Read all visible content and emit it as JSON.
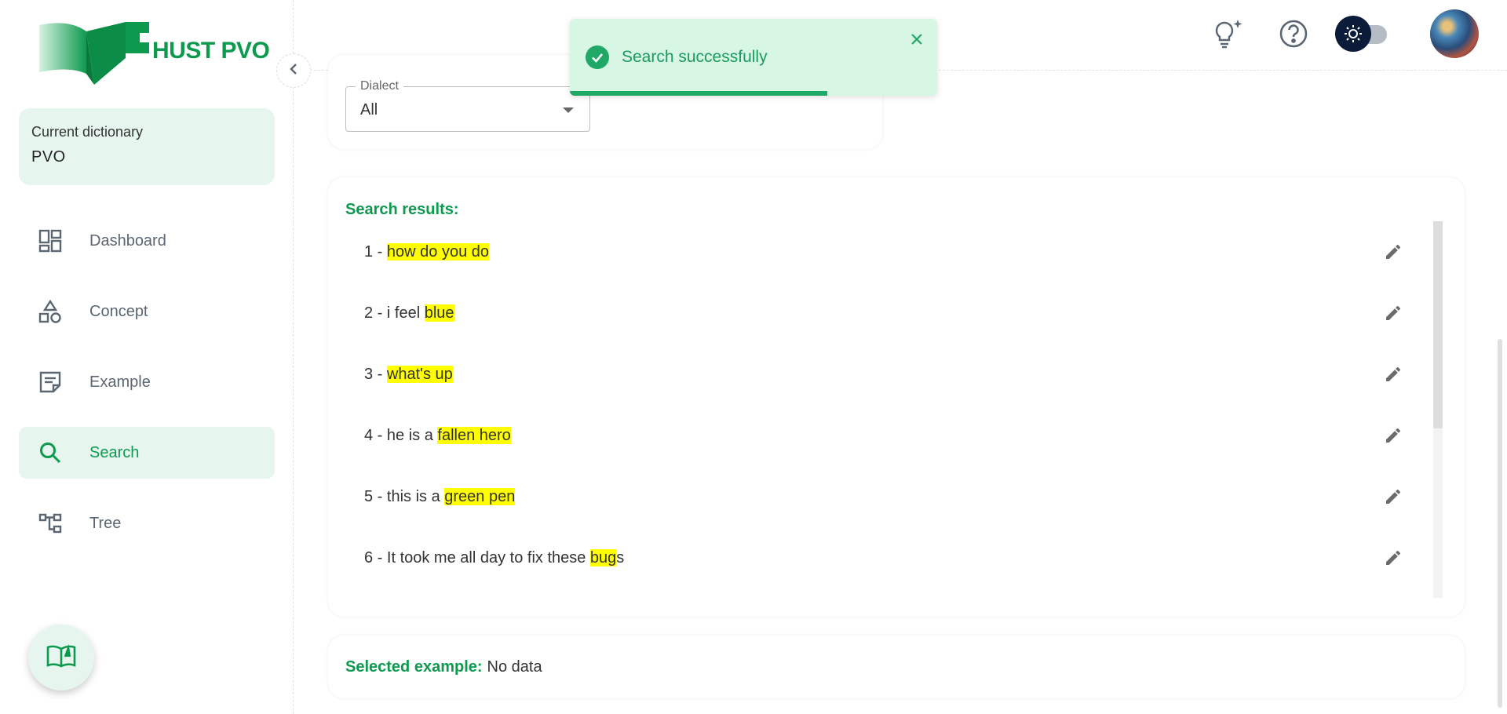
{
  "app": {
    "logo_text": "HUST PVO"
  },
  "sidebar": {
    "current_dictionary_label": "Current dictionary",
    "current_dictionary_value": "PVO",
    "items": [
      {
        "label": "Dashboard",
        "icon": "dashboard-icon",
        "active": false
      },
      {
        "label": "Concept",
        "icon": "concept-icon",
        "active": false
      },
      {
        "label": "Example",
        "icon": "example-icon",
        "active": false
      },
      {
        "label": "Search",
        "icon": "search-icon",
        "active": true
      },
      {
        "label": "Tree",
        "icon": "tree-icon",
        "active": false
      }
    ]
  },
  "header": {
    "icons": [
      "lightbulb-icon",
      "help-icon",
      "theme-toggle",
      "avatar"
    ]
  },
  "filter": {
    "dialect_label": "Dialect",
    "dialect_value": "All"
  },
  "results": {
    "title": "Search results:",
    "items": [
      {
        "index": "1",
        "sep": " - ",
        "before": "",
        "highlight": "how do you do",
        "after": ""
      },
      {
        "index": "2",
        "sep": " - ",
        "before": "i feel ",
        "highlight": "blue",
        "after": ""
      },
      {
        "index": "3",
        "sep": " - ",
        "before": "",
        "highlight": "what's up",
        "after": ""
      },
      {
        "index": "4",
        "sep": " - ",
        "before": "he is a ",
        "highlight": "fallen hero",
        "after": ""
      },
      {
        "index": "5",
        "sep": " - ",
        "before": "this is a ",
        "highlight": "green pen",
        "after": ""
      },
      {
        "index": "6",
        "sep": " - ",
        "before": "It took me all day to fix these ",
        "highlight": "bug",
        "after": "s"
      }
    ]
  },
  "selected": {
    "label": "Selected example:",
    "value": "No data"
  },
  "toast": {
    "message": "Search successfully",
    "progress": 0.7
  },
  "colors": {
    "brand": "#0d9a4f",
    "accent_bg": "#e6f6ee",
    "highlight": "#ffff00",
    "toast_bg": "#d7f6e3"
  }
}
